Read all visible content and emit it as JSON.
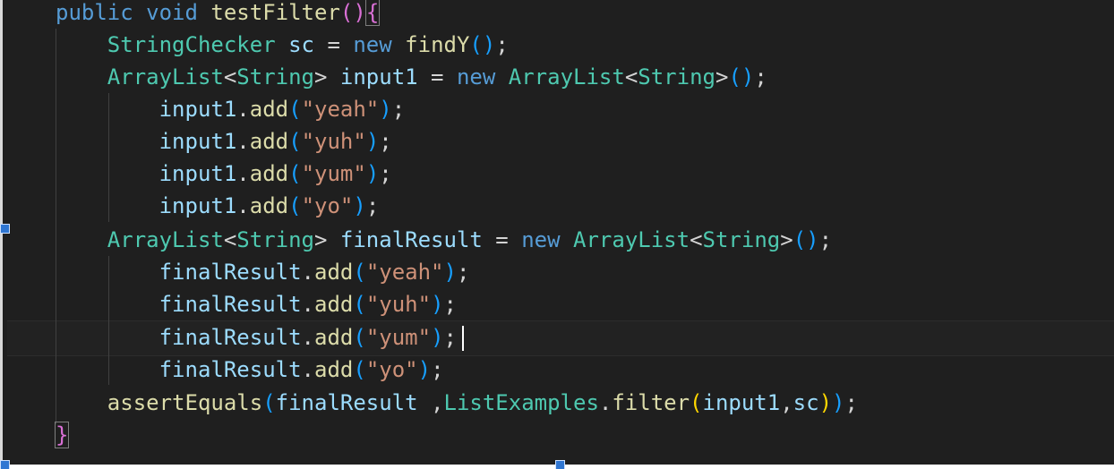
{
  "editor": {
    "language": "java",
    "colors": {
      "background": "#1f1f1f",
      "keyword": "#569cd6",
      "type": "#4ec9b0",
      "variable": "#9cdcfe",
      "function": "#dcdcaa",
      "string": "#ce9178",
      "punctuation": "#d4d4d4",
      "bracket_level_1": "#da70d6",
      "bracket_level_2": "#179fff",
      "bracket_level_3": "#ffd700"
    },
    "lines": [
      {
        "tokens": [
          "public",
          " ",
          "void",
          " ",
          "testFilter",
          "(",
          ")",
          "{"
        ]
      },
      {
        "tokens": [
          "    ",
          "StringChecker",
          " ",
          "sc",
          " = ",
          "new",
          " ",
          "findY",
          "(",
          ")",
          ";"
        ]
      },
      {
        "tokens": [
          "    ",
          "ArrayList",
          "<",
          "String",
          "> ",
          "input1",
          " = ",
          "new",
          " ",
          "ArrayList",
          "<",
          "String",
          ">",
          "(",
          ")",
          ";"
        ]
      },
      {
        "tokens": [
          "        ",
          "input1",
          ".",
          "add",
          "(",
          "\"yeah\"",
          ")",
          ";"
        ]
      },
      {
        "tokens": [
          "        ",
          "input1",
          ".",
          "add",
          "(",
          "\"yuh\"",
          ")",
          ";"
        ]
      },
      {
        "tokens": [
          "        ",
          "input1",
          ".",
          "add",
          "(",
          "\"yum\"",
          ")",
          ";"
        ]
      },
      {
        "tokens": [
          "        ",
          "input1",
          ".",
          "add",
          "(",
          "\"yo\"",
          ")",
          ";"
        ]
      },
      {
        "tokens": [
          "    ",
          "ArrayList",
          "<",
          "String",
          "> ",
          "finalResult",
          " = ",
          "new",
          " ",
          "ArrayList",
          "<",
          "String",
          ">",
          "(",
          ")",
          ";"
        ]
      },
      {
        "tokens": [
          "        ",
          "finalResult",
          ".",
          "add",
          "(",
          "\"yeah\"",
          ")",
          ";"
        ]
      },
      {
        "tokens": [
          "        ",
          "finalResult",
          ".",
          "add",
          "(",
          "\"yuh\"",
          ")",
          ";"
        ]
      },
      {
        "tokens": [
          "        ",
          "finalResult",
          ".",
          "add",
          "(",
          "\"yum\"",
          ")",
          ";"
        ]
      },
      {
        "tokens": [
          "        ",
          "finalResult",
          ".",
          "add",
          "(",
          "\"yo\"",
          ")",
          ";"
        ]
      },
      {
        "tokens": [
          "    ",
          "assertEquals",
          "(",
          "finalResult",
          " ,",
          "ListExamples",
          ".",
          "filter",
          "(",
          "input1",
          ",",
          "sc",
          ")",
          ")",
          ";"
        ]
      },
      {
        "tokens": [
          "}"
        ]
      }
    ]
  }
}
